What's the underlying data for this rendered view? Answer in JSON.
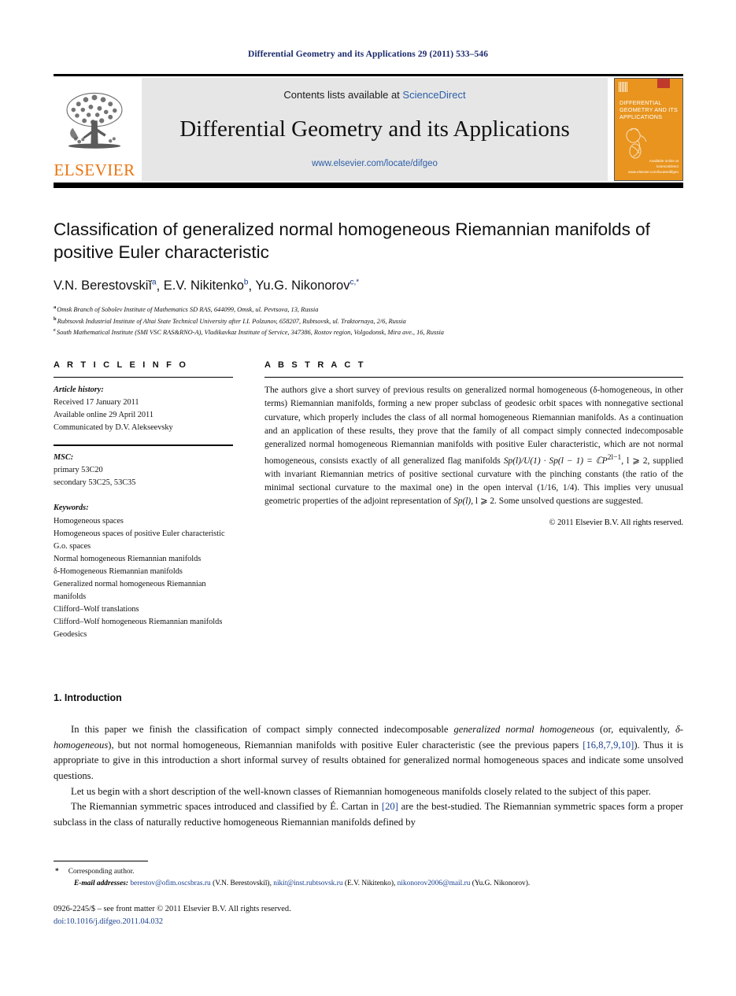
{
  "running_head": "Differential Geometry and its Applications 29 (2011) 533–546",
  "masthead": {
    "contents_prefix": "Contents lists available at ",
    "contents_link": "ScienceDirect",
    "journal_title": "Differential Geometry and its Applications",
    "journal_url": "www.elsevier.com/locate/difgeo",
    "publisher_wordmark": "ELSEVIER",
    "cover": {
      "title_lines": [
        "DIFFERENTIAL",
        "GEOMETRY AND ITS",
        "APPLICATIONS"
      ],
      "foot_lines": [
        "Available online at",
        "ScienceDirect",
        "www.elsevier.com/locate/difgeo"
      ],
      "background_color": "#E8941E"
    },
    "band_color": "#e6e6e6",
    "link_color": "#2c5fa8",
    "brand_color": "#E87511"
  },
  "title_block": {
    "title": "Classification of generalized normal homogeneous Riemannian manifolds of positive Euler characteristic",
    "authors": [
      {
        "name": "V.N. Berestovskiĭ",
        "marks": "a"
      },
      {
        "name": "E.V. Nikitenko",
        "marks": "b"
      },
      {
        "name": "Yu.G. Nikonorov",
        "marks": "c,*"
      }
    ],
    "affiliations": [
      {
        "mark": "a",
        "text": "Omsk Branch of Sobolev Institute of Mathematics SD RAS, 644099, Omsk, ul. Pevtsova, 13, Russia"
      },
      {
        "mark": "b",
        "text": "Rubtsovsk Industrial Institute of Altai State Technical University after I.I. Polzunov, 658207, Rubtsovsk, ul. Traktornaya, 2/6, Russia"
      },
      {
        "mark": "c",
        "text": "South Mathematical Institute (SMI VSC RAS&RNO-A), Vladikavkaz Institute of Service, 347386, Rostov region, Volgodonsk, Mira ave., 16, Russia"
      }
    ]
  },
  "article_info": {
    "heading": "A R T I C L E   I N F O",
    "history_label": "Article history:",
    "history_lines": [
      "Received 17 January 2011",
      "Available online 29 April 2011",
      "Communicated by D.V. Alekseevsky"
    ],
    "msc_label": "MSC:",
    "msc_lines": [
      "primary 53C20",
      "secondary 53C25, 53C35"
    ],
    "keywords_label": "Keywords:",
    "keywords": [
      "Homogeneous spaces",
      "Homogeneous spaces of positive Euler characteristic",
      "G.o. spaces",
      "Normal homogeneous Riemannian manifolds",
      "δ-Homogeneous Riemannian manifolds",
      "Generalized normal homogeneous Riemannian manifolds",
      "Clifford–Wolf translations",
      "Clifford–Wolf homogeneous Riemannian manifolds",
      "Geodesics"
    ]
  },
  "abstract": {
    "heading": "A B S T R A C T",
    "part1": "The authors give a short survey of previous results on generalized normal homogeneous (δ-homogeneous, in other terms) Riemannian manifolds, forming a new proper subclass of geodesic orbit spaces with nonnegative sectional curvature, which properly includes the class of all normal homogeneous Riemannian manifolds. As a continuation and an application of these results, they prove that the family of all compact simply connected indecomposable generalized normal homogeneous Riemannian manifolds with positive Euler characteristic, which are not normal homogeneous, consists exactly of all generalized flag manifolds ",
    "formula": "Sp(l)/U(1) · Sp(l − 1) = ℂP",
    "formula_exp": "2l−1",
    "formula_tail": ", l ⩾ 2,",
    "part2": " supplied with invariant Riemannian metrics of positive sectional curvature with the pinching constants (the ratio of the minimal sectional curvature to the maximal one) in the open interval (1/16, 1/4). This implies very unusual geometric properties of the adjoint representation of ",
    "formula2": "Sp(l)",
    "formula2_tail": ", l ⩾ 2.",
    "part3": " Some unsolved questions are suggested.",
    "copyright": "© 2011 Elsevier B.V. All rights reserved."
  },
  "body": {
    "section_number_title": "1. Introduction",
    "p1_a": "In this paper we finish the classification of compact simply connected indecomposable ",
    "p1_it1": "generalized normal homogeneous",
    "p1_b": " (or, equivalently, ",
    "p1_it2": "δ-homogeneous",
    "p1_c": "), but not normal homogeneous, Riemannian manifolds with positive Euler characteristic (see the previous papers ",
    "p1_ref": "[16,8,7,9,10]",
    "p1_d": "). Thus it is appropriate to give in this introduction a short informal survey of results obtained for generalized normal homogeneous spaces and indicate some unsolved questions.",
    "p2": "Let us begin with a short description of the well-known classes of Riemannian homogeneous manifolds closely related to the subject of this paper.",
    "p3_a": "The Riemannian symmetric spaces introduced and classified by É. Cartan in ",
    "p3_ref": "[20]",
    "p3_b": " are the best-studied. The Riemannian symmetric spaces form a proper subclass in the class of naturally reductive homogeneous Riemannian manifolds defined by"
  },
  "footnotes": {
    "corresponding": "Corresponding author.",
    "corresponding_mark": "*",
    "emails_label": "E-mail addresses:",
    "emails": [
      {
        "address": "berestov@ofim.oscsbras.ru",
        "owner": "(V.N. Berestovskiĭ)"
      },
      {
        "address": "nikit@inst.rubtsovsk.ru",
        "owner": "(E.V. Nikitenko)"
      },
      {
        "address": "nikonorov2006@mail.ru",
        "owner": "(Yu.G. Nikonorov)"
      }
    ],
    "imprint": "0926-2245/$ – see front matter  © 2011 Elsevier B.V. All rights reserved.",
    "doi": "doi:10.1016/j.difgeo.2011.04.032",
    "link_color": "#1a3f8f"
  }
}
